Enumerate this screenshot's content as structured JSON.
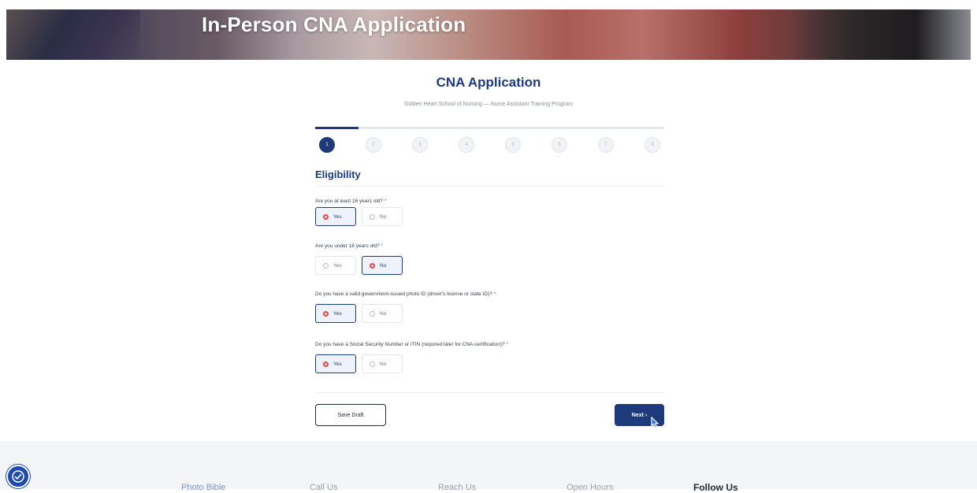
{
  "hero": {
    "title": "In-Person CNA Application"
  },
  "form": {
    "title": "CNA Application",
    "subtitle": "Golden Heart School of Nursing — Nurse Assistant Training Program",
    "progress_fraction": 0.125,
    "steps": [
      "1",
      "2",
      "3",
      "4",
      "5",
      "6",
      "7",
      "8"
    ],
    "current_step": 1,
    "section_title": "Eligibility",
    "questions": [
      {
        "label": "Are you at least 16 years old?",
        "required": "*",
        "options": [
          "Yes",
          "No"
        ],
        "selected": "Yes"
      },
      {
        "label": "Are you under 18 years old?",
        "required": "*",
        "options": [
          "Yes",
          "No"
        ],
        "selected": "No"
      },
      {
        "label": "Do you have a valid government-issued photo ID (driver's license or state ID)?",
        "required": "*",
        "options": [
          "Yes",
          "No"
        ],
        "selected": "Yes"
      },
      {
        "label": "Do you have a Social Security Number or ITIN (required later for CNA certification)?",
        "required": "*",
        "options": [
          "Yes",
          "No"
        ],
        "selected": "Yes"
      }
    ],
    "buttons": {
      "save_draft": "Save Draft",
      "next": "Next ›"
    }
  },
  "footer": {
    "links": [
      "Photo Bible",
      "Call Us",
      "Reach Us",
      "Open Hours"
    ],
    "follow": "Follow Us"
  },
  "icons": {
    "accessibility": "accessibility-icon",
    "cursor": "pointer-cursor-icon"
  },
  "colors": {
    "primary": "#1e3a7a",
    "radio_selected": "#e04b4b",
    "footer_bg": "#f3f5f7"
  }
}
